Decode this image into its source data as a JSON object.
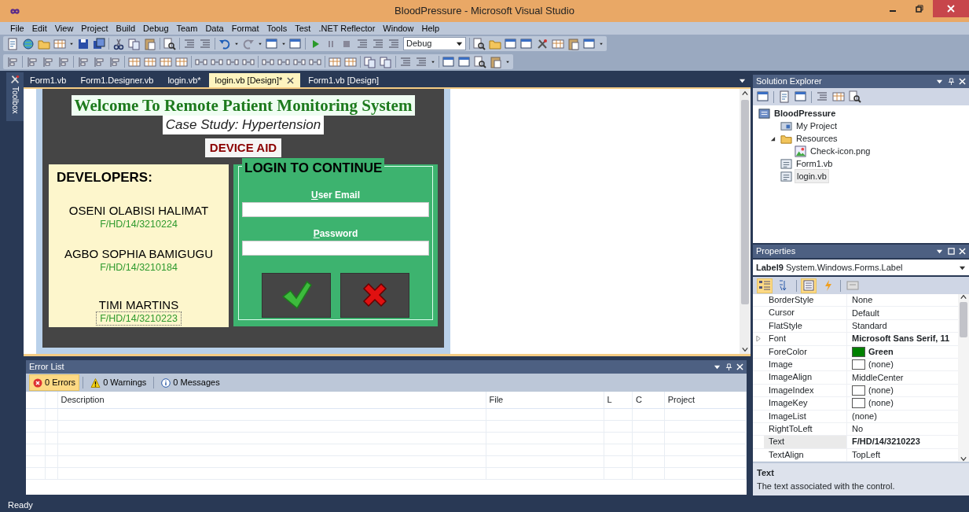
{
  "window": {
    "title": "BloodPressure - Microsoft Visual Studio"
  },
  "menu": [
    "File",
    "Edit",
    "View",
    "Project",
    "Build",
    "Debug",
    "Team",
    "Data",
    "Format",
    "Tools",
    "Test",
    ".NET Reflector",
    "Window",
    "Help"
  ],
  "toolbar": {
    "configuration": "Debug"
  },
  "toolbox": {
    "label": "Toolbox"
  },
  "document_tabs": [
    {
      "label": "Form1.vb",
      "selected": false
    },
    {
      "label": "Form1.Designer.vb",
      "selected": false
    },
    {
      "label": "login.vb*",
      "selected": false
    },
    {
      "label": "login.vb [Design]*",
      "selected": true
    },
    {
      "label": "Form1.vb [Design]",
      "selected": false
    }
  ],
  "form": {
    "title": "Welcome To Remote Patient Monitoring System",
    "subtitle": "Case Study: Hypertension",
    "badge": "DEVICE AID",
    "developers": {
      "heading": "DEVELOPERS:",
      "people": [
        {
          "name": "OSENI OLABISI HALIMAT",
          "id": "F/HD/14/3210224",
          "selected": false
        },
        {
          "name": "AGBO SOPHIA BAMIGUGU",
          "id": "F/HD/14/3210184",
          "selected": false
        },
        {
          "name": "TIMI MARTINS",
          "id": "F/HD/14/3210223",
          "selected": true
        }
      ]
    },
    "login": {
      "heading": "LOGIN TO CONTINUE",
      "fields": [
        {
          "label": "User Email"
        },
        {
          "label": "Password"
        }
      ],
      "buttons": [
        {
          "kind": "confirm"
        },
        {
          "kind": "cancel"
        }
      ]
    }
  },
  "error_list": {
    "title": "Error List",
    "filters": [
      {
        "kind": "error",
        "label": "0 Errors",
        "selected": true
      },
      {
        "kind": "warning",
        "label": "0 Warnings",
        "selected": false
      },
      {
        "kind": "info",
        "label": "0 Messages",
        "selected": false
      }
    ],
    "columns": [
      "Description",
      "File",
      "L",
      "C",
      "Project"
    ]
  },
  "solution_explorer": {
    "title": "Solution Explorer",
    "tree": [
      {
        "label": "BloodPressure",
        "kind": "project",
        "selected": false,
        "children": [
          {
            "label": "My Project",
            "kind": "settings",
            "selected": false
          },
          {
            "label": "Resources",
            "kind": "folder",
            "selected": false,
            "expanded": true,
            "children": [
              {
                "label": "Check-icon.png",
                "kind": "image",
                "selected": false
              }
            ]
          },
          {
            "label": "Form1.vb",
            "kind": "form",
            "selected": false
          },
          {
            "label": "login.vb",
            "kind": "form",
            "selected": true
          }
        ]
      }
    ]
  },
  "properties": {
    "title": "Properties",
    "object": {
      "name": "Label9",
      "type": "System.Windows.Forms.Label"
    },
    "view_buttons": [
      {
        "kind": "categorized",
        "selected": true
      },
      {
        "kind": "alphabetical",
        "selected": false
      },
      {
        "kind": "properties",
        "selected": true
      },
      {
        "kind": "events",
        "selected": false
      },
      {
        "kind": "pages",
        "selected": false
      }
    ],
    "rows": [
      {
        "name": "BorderStyle",
        "value": "None",
        "kind": "text",
        "selected": false
      },
      {
        "name": "Cursor",
        "value": "Default",
        "kind": "text",
        "selected": false
      },
      {
        "name": "FlatStyle",
        "value": "Standard",
        "kind": "text",
        "selected": false
      },
      {
        "name": "Font",
        "value": "Microsoft Sans Serif, 11",
        "kind": "text",
        "bold": true,
        "selected": false,
        "expandable": true
      },
      {
        "name": "ForeColor",
        "value": "Green",
        "kind": "color",
        "color": "#008000",
        "bold": true,
        "selected": false
      },
      {
        "name": "Image",
        "value": "(none)",
        "kind": "image",
        "selected": false
      },
      {
        "name": "ImageAlign",
        "value": "MiddleCenter",
        "kind": "text",
        "selected": false
      },
      {
        "name": "ImageIndex",
        "value": "(none)",
        "kind": "image",
        "selected": false
      },
      {
        "name": "ImageKey",
        "value": "(none)",
        "kind": "image",
        "selected": false
      },
      {
        "name": "ImageList",
        "value": "(none)",
        "kind": "text",
        "selected": false
      },
      {
        "name": "RightToLeft",
        "value": "No",
        "kind": "text",
        "selected": false
      },
      {
        "name": "Text",
        "value": "F/HD/14/3210223",
        "kind": "text",
        "bold": true,
        "selected": true
      },
      {
        "name": "TextAlign",
        "value": "TopLeft",
        "kind": "text",
        "selected": false
      }
    ],
    "description": {
      "title": "Text",
      "text": "The text associated with the control."
    }
  },
  "status_bar": {
    "text": "Ready"
  }
}
